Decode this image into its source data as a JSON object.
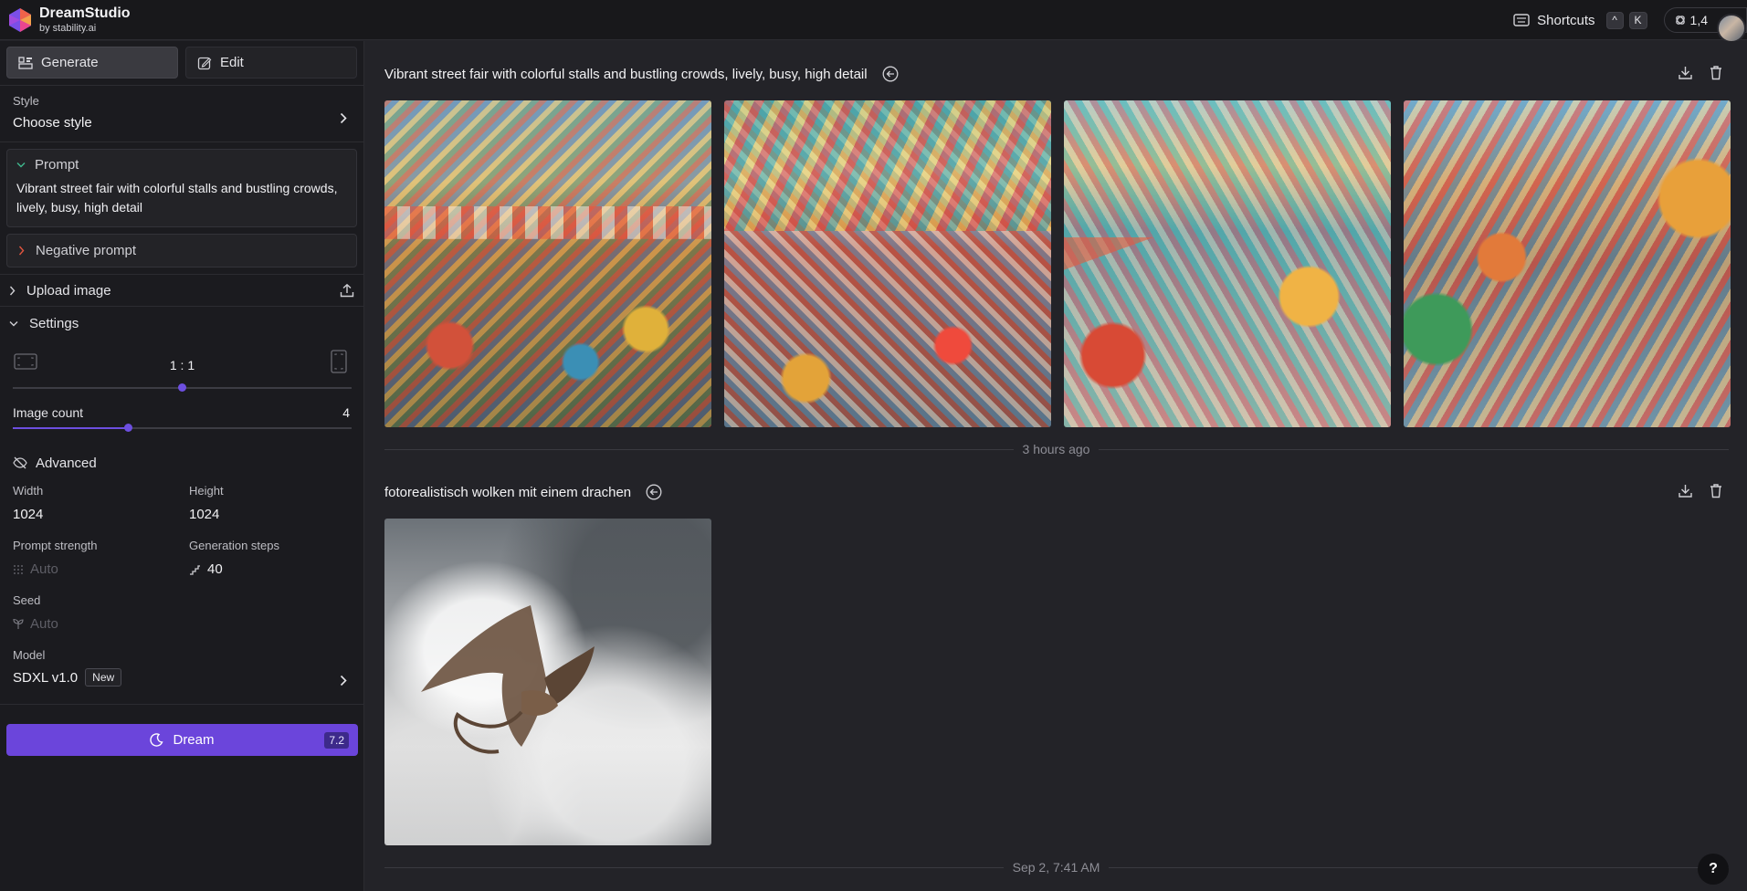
{
  "app": {
    "name": "DreamStudio",
    "sub": "by stability.ai",
    "brand_color": "#6b45db"
  },
  "topbar": {
    "shortcuts_label": "Shortcuts",
    "key1": "^",
    "key2": "K",
    "credits": "1,4"
  },
  "tabs": [
    {
      "label": "Generate",
      "active": true
    },
    {
      "label": "Edit",
      "active": false
    }
  ],
  "style": {
    "label": "Style",
    "value": "Choose style"
  },
  "prompt": {
    "label": "Prompt",
    "text": "Vibrant street fair with colorful stalls and bustling crowds, lively, busy, high detail"
  },
  "negative_prompt": {
    "label": "Negative prompt"
  },
  "upload": {
    "label": "Upload image"
  },
  "settings": {
    "label": "Settings",
    "aspect_ratio": "1 : 1",
    "image_count_label": "Image count",
    "image_count": "4",
    "advanced_label": "Advanced",
    "width_label": "Width",
    "width": "1024",
    "height_label": "Height",
    "height": "1024",
    "prompt_strength_label": "Prompt strength",
    "prompt_strength": "Auto",
    "steps_label": "Generation steps",
    "steps": "40",
    "seed_label": "Seed",
    "seed": "Auto"
  },
  "model": {
    "label": "Model",
    "value": "SDXL v1.0",
    "badge": "New"
  },
  "dream": {
    "label": "Dream",
    "cost": "7.2"
  },
  "generations": [
    {
      "prompt": "Vibrant street fair with colorful stalls and bustling crowds, lively, busy, high detail",
      "time": "3 hours ago",
      "images": 4
    },
    {
      "prompt": "fotorealistisch wolken mit einem drachen",
      "time": "Sep 2, 7:41 AM",
      "images": 1
    }
  ],
  "help": "?"
}
